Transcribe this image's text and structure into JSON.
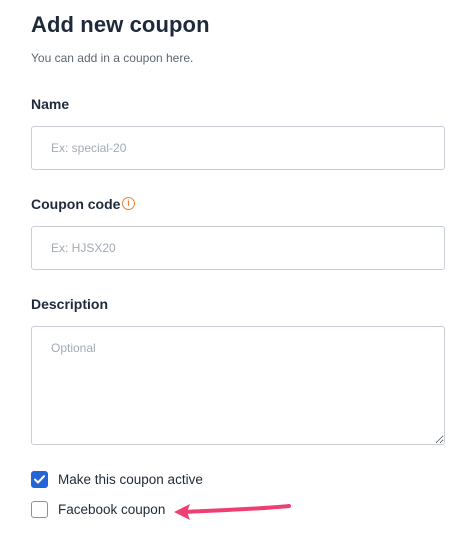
{
  "header": {
    "title": "Add new coupon",
    "subtitle": "You can add in a coupon here."
  },
  "form": {
    "name": {
      "label": "Name",
      "placeholder": "Ex: special-20",
      "value": ""
    },
    "coupon_code": {
      "label": "Coupon code",
      "placeholder": "Ex: HJSX20",
      "value": "",
      "info_icon": "info-icon"
    },
    "description": {
      "label": "Description",
      "placeholder": "Optional",
      "value": ""
    },
    "active_checkbox": {
      "label": "Make this coupon active",
      "checked": true
    },
    "facebook_checkbox": {
      "label": "Facebook coupon",
      "checked": false
    }
  },
  "annotation": {
    "icon": "arrow-left-icon",
    "color": "#ee3f72"
  },
  "colors": {
    "accent": "#2563d9",
    "info": "#e8823e",
    "arrow": "#ee3f72"
  }
}
